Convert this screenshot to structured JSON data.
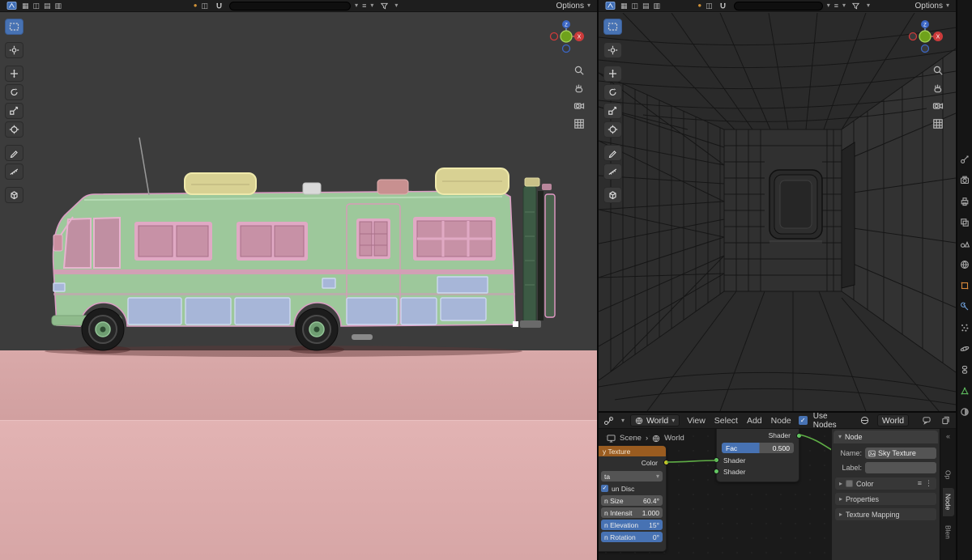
{
  "colors": {
    "accent": "#4772b3",
    "field_bg": "#545454",
    "node_header_orange": "#9a5c20",
    "wire_green": "#5fae46",
    "viewport_left_bg": "#3c3c3c",
    "viewport_right_bg": "#2e2e2e",
    "node_editor_bg": "#1a1a1a",
    "ground_pink": "#d9a8a8",
    "rv_body_green": "#9dc89b",
    "rv_window_pink": "#c791a6",
    "outline_pink": "#db9ec4"
  },
  "left_viewport": {
    "options_label": "Options",
    "tools": [
      "box-select",
      "cursor",
      "move",
      "rotate",
      "scale",
      "transform",
      "annotate",
      "measure",
      "add-primitive"
    ],
    "gizmo": {
      "x": "X",
      "z": "Z"
    }
  },
  "right_viewport": {
    "options_label": "Options",
    "gizmo": {
      "x": "X",
      "z": "Z"
    }
  },
  "shader_editor": {
    "header": {
      "shader_type": "World",
      "menus": [
        "View",
        "Select",
        "Add",
        "Node"
      ],
      "use_nodes_label": "Use Nodes",
      "use_nodes_checked": true,
      "datablock_name": "World"
    },
    "breadcrumb": {
      "scene": "Scene",
      "separator": "›",
      "world": "World"
    },
    "sky_node": {
      "title": "y Texture",
      "output_label": "Color",
      "type_value": "ta",
      "sun_disc_label": "un Disc",
      "fields": [
        {
          "label": "n Size",
          "value": "60.4°",
          "highlight": false
        },
        {
          "label": "n Intensit",
          "value": "1.000",
          "highlight": false
        },
        {
          "label": "n Elevation",
          "value": "15°",
          "highlight": true
        },
        {
          "label": "n Rotation",
          "value": "0°",
          "highlight": true
        }
      ]
    },
    "mix_node": {
      "output_label": "Shader",
      "fac_label": "Fac",
      "fac_value": "0.500",
      "input1_label": "Shader",
      "input2_label": "Shader"
    },
    "sidebar": {
      "panel_title": "Node",
      "name_label": "Name:",
      "name_value": "Sky Texture",
      "label_label": "Label:",
      "label_value": "",
      "sections": [
        "Color",
        "Properties",
        "Texture Mapping"
      ],
      "tabs": [
        "Op",
        "Node",
        "Blen"
      ],
      "active_tab": "Node"
    }
  },
  "properties_strip": {
    "icons": [
      "tool",
      "render",
      "output",
      "view-layer",
      "scene",
      "world",
      "object",
      "modifiers",
      "particles",
      "physics",
      "constraints",
      "object-data",
      "material"
    ]
  }
}
